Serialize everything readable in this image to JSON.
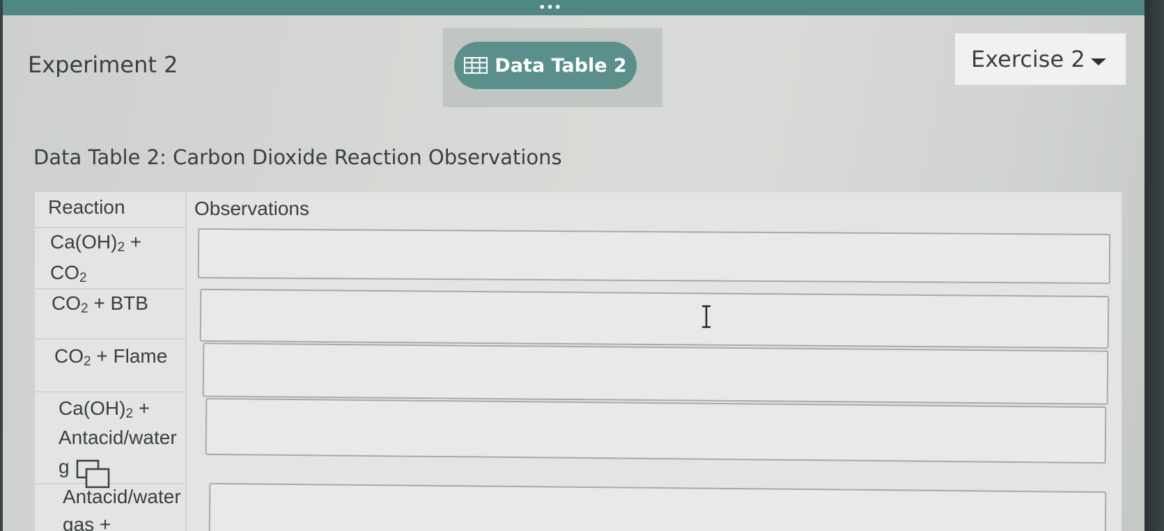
{
  "header": {
    "grip": "•••",
    "experiment_title": "Experiment 2",
    "tab_label": "Data Table 2",
    "exercise_select": "Exercise 2"
  },
  "table": {
    "title": "Data Table 2: Carbon Dioxide Reaction Observations",
    "col_reaction": "Reaction",
    "col_observations": "Observations",
    "rows": [
      {
        "reaction_line1_a": "Ca(OH)",
        "reaction_line1_sub": "2",
        "reaction_line1_b": " +",
        "reaction_line2_a": "CO",
        "reaction_line2_sub": "2",
        "observation": ""
      },
      {
        "reaction_a": "CO",
        "reaction_sub": "2",
        "reaction_b": " + BTB",
        "observation": ""
      },
      {
        "reaction_a": "CO",
        "reaction_sub": "2",
        "reaction_b": " + Flame",
        "observation": ""
      },
      {
        "reaction_line1_a": "Ca(OH)",
        "reaction_line1_sub": "2",
        "reaction_line1_b": " +",
        "reaction_line2": "Antacid/water",
        "reaction_line3": "g",
        "observation": ""
      },
      {
        "reaction_line1": "Antacid/water",
        "reaction_line2": "gas +",
        "observation": ""
      }
    ]
  },
  "icons": {
    "tab_icon": "table-grid-icon",
    "select_icon": "caret-down-icon",
    "cursor_icon": "text-cursor-icon",
    "overlay_icon": "copy-icon"
  },
  "colors": {
    "accent": "#5a8f8c",
    "topbar": "#4f8784"
  }
}
